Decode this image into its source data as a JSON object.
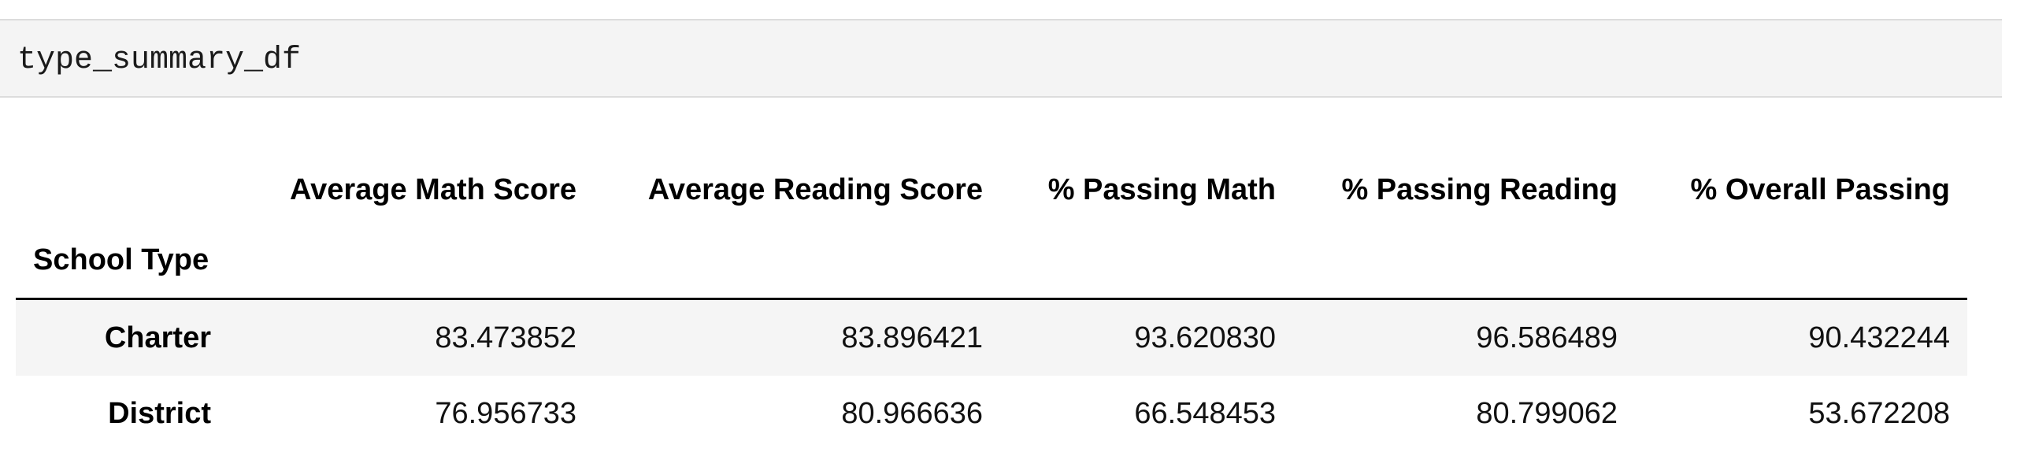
{
  "code_cell": {
    "source": "type_summary_df"
  },
  "dataframe": {
    "index_name": "School Type",
    "columns": [
      "Average Math Score",
      "Average Reading Score",
      "% Passing Math",
      "% Passing Reading",
      "% Overall Passing"
    ],
    "rows": [
      {
        "index": "Charter",
        "values": [
          "83.473852",
          "83.896421",
          "93.620830",
          "96.586489",
          "90.432244"
        ]
      },
      {
        "index": "District",
        "values": [
          "76.956733",
          "80.966636",
          "66.548453",
          "80.799062",
          "53.672208"
        ]
      }
    ]
  }
}
